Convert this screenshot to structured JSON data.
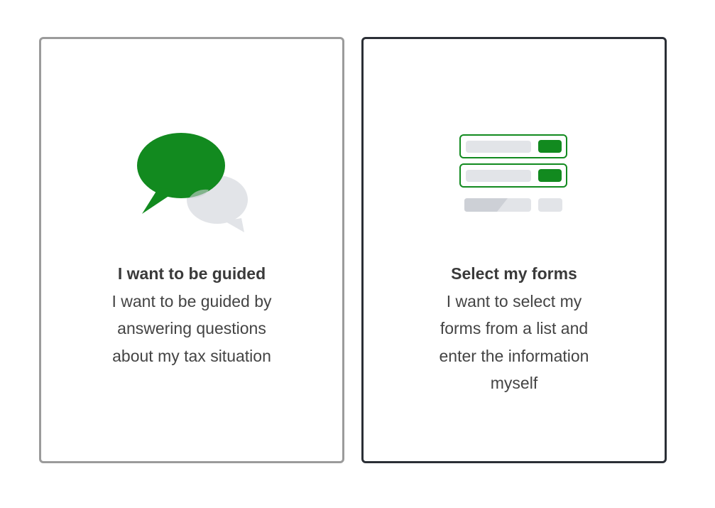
{
  "options": {
    "guided": {
      "title": "I want to be guided",
      "description": "I want to be guided by answering questions about my tax situation",
      "icon": "chat-bubbles-icon"
    },
    "forms": {
      "title": "Select my forms",
      "description": "I want to select my forms from a list and enter the information myself",
      "icon": "form-list-icon"
    }
  },
  "colors": {
    "accent_green": "#128a1f",
    "light_gray": "#e2e4e8",
    "mid_gray": "#cdd0d6",
    "guided_border": "#9b9b9b",
    "forms_border": "#2b2f36",
    "text": "#3d3d3d"
  }
}
